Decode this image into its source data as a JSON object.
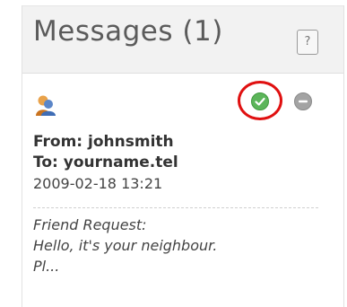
{
  "panel": {
    "title": "Messages (1)",
    "help_label": "?"
  },
  "message": {
    "icon": "user-icon",
    "accept_icon": "check-circle-icon",
    "decline_icon": "minus-circle-icon",
    "from": "From: johnsmith",
    "to": "To: yourname.tel",
    "timestamp": "2009-02-18 13:21",
    "body_lines": [
      "Friend Request:",
      "Hello, it's your neighbour.",
      "Pl..."
    ]
  },
  "colors": {
    "accept": "#5cb55a",
    "decline": "#9e9e9e",
    "highlight_ring": "#e01010",
    "header_bg": "#f2f2f2"
  }
}
